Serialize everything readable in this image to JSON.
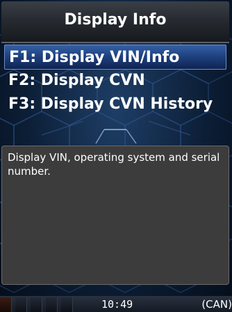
{
  "header": {
    "title": "Display Info"
  },
  "menu": {
    "selected_index": 0,
    "items": [
      {
        "label": "F1: Display VIN/Info"
      },
      {
        "label": "F2: Display CVN"
      },
      {
        "label": "F3: Display CVN History"
      }
    ]
  },
  "description": {
    "text": "Display VIN, operating system and serial number."
  },
  "status_bar": {
    "time": "10:49",
    "protocol": "(CAN)"
  },
  "colors": {
    "background": "#0c1e36",
    "selection": "#1d3f7c",
    "description_box": "#3c3c3c"
  }
}
